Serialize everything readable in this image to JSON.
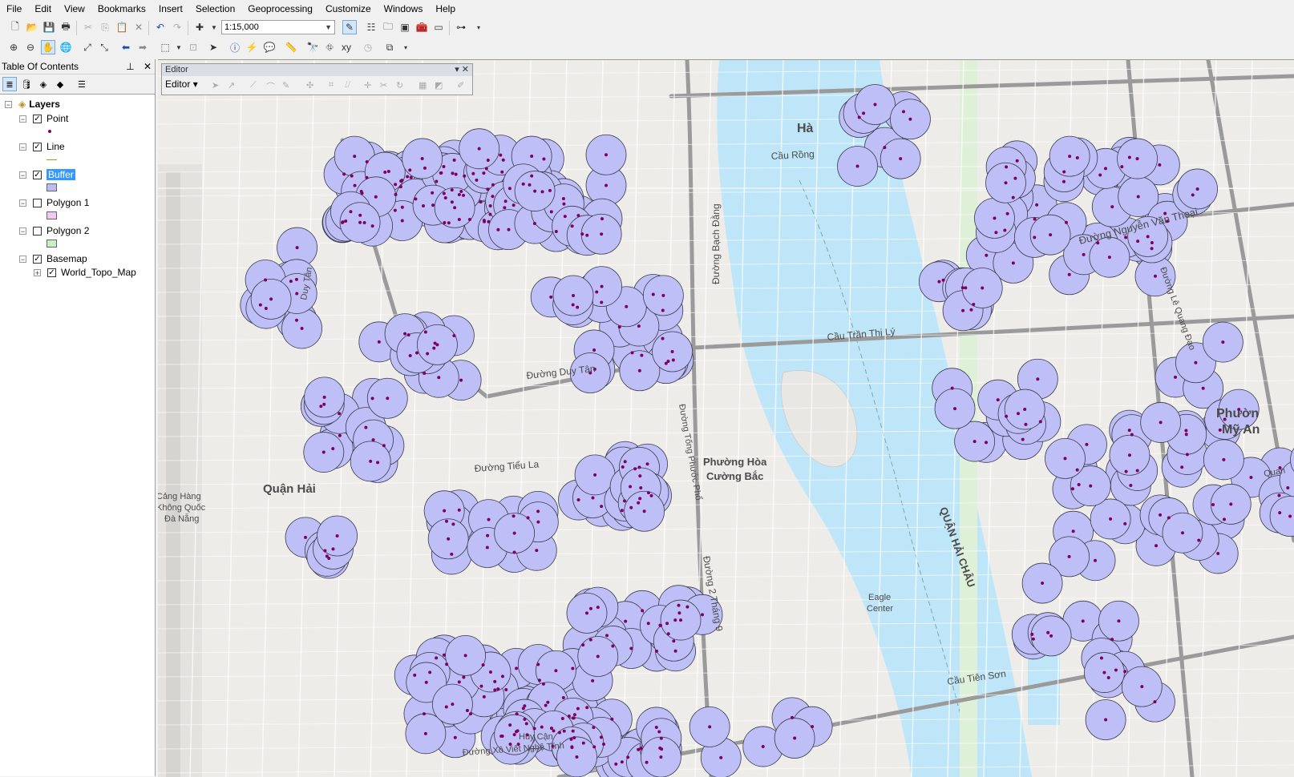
{
  "menu": [
    "File",
    "Edit",
    "View",
    "Bookmarks",
    "Insert",
    "Selection",
    "Geoprocessing",
    "Customize",
    "Windows",
    "Help"
  ],
  "toolbar": {
    "scale_value": "1:15,000"
  },
  "toc": {
    "title": "Table Of Contents",
    "pin_glyph": "⸽",
    "close_glyph": "✕",
    "root_label": "Layers",
    "layers": [
      {
        "label": "Point",
        "checked": true,
        "symbol": "point"
      },
      {
        "label": "Line",
        "checked": true,
        "symbol": "line"
      },
      {
        "label": "Buffer",
        "checked": true,
        "symbol": "poly",
        "color": "#bcbcf5",
        "selected": true
      },
      {
        "label": "Polygon 1",
        "checked": false,
        "symbol": "poly",
        "color": "#f0c8f0"
      },
      {
        "label": "Polygon 2",
        "checked": false,
        "symbol": "poly",
        "color": "#c8f0c8"
      },
      {
        "label": "Basemap",
        "checked": true,
        "symbol": "group"
      }
    ],
    "sublayer": "World_Topo_Map"
  },
  "editor": {
    "title": "Editor",
    "menu_label": "Editor"
  },
  "map": {
    "labels": [
      {
        "text": "Hà"
      },
      {
        "text": "Cầu Rồng"
      },
      {
        "text": "Đường Bạch Đằng"
      },
      {
        "text": "Cầu Trần Thị Lý"
      },
      {
        "text": "Đường Duy Tân"
      },
      {
        "text": "Đường Nguyễn Văn Thoại"
      },
      {
        "text": "Phường Hòa"
      },
      {
        "text": "Cường Bắc"
      },
      {
        "text": "Quận Hải"
      },
      {
        "text": "Cảng Hàng"
      },
      {
        "text": "Không Quốc"
      },
      {
        "text": "Đà Nẵng"
      },
      {
        "text": "Đường Tiểu La"
      },
      {
        "text": "Đường 2 Tháng 9"
      },
      {
        "text": "Eagle"
      },
      {
        "text": "Center"
      },
      {
        "text": "QUẬN HẢI CHÂU"
      },
      {
        "text": "Cầu Tiên Sơn"
      },
      {
        "text": "Phườn"
      },
      {
        "text": "Mỹ An"
      },
      {
        "text": "Duy Tân"
      },
      {
        "text": "Đường Tống Phước Phổ"
      },
      {
        "text": "Huy Cận"
      },
      {
        "text": "Đường Xô Viết Nghệ Tĩnh"
      },
      {
        "text": "Quan"
      },
      {
        "text": "Đường Lê Quang Đạo"
      }
    ],
    "buffer_fill": "#bfbff7",
    "buffer_stroke": "#3a3a4a",
    "point_color": "#800060",
    "water_color": "#bfe6f8",
    "road_color": "#9a9a9a"
  }
}
